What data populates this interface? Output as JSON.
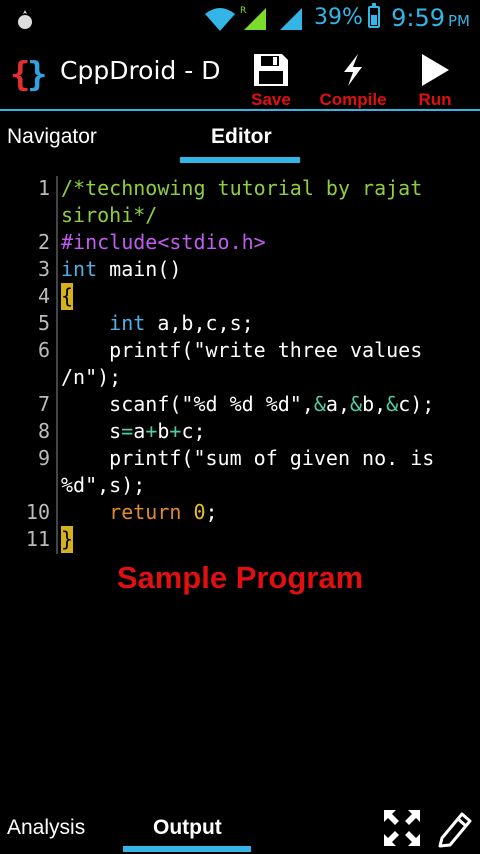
{
  "status": {
    "battery_pct": "39%",
    "time": "9:59",
    "ampm": "PM"
  },
  "app": {
    "title": "CppDroid - D"
  },
  "actions": {
    "save": "Save",
    "compile": "Compile",
    "run": "Run"
  },
  "tabs": [
    {
      "label": "Navigator"
    },
    {
      "label": "Editor"
    }
  ],
  "editor": {
    "lines": [
      {
        "n": "1",
        "y": 0
      },
      {
        "n": "",
        "y": 1
      },
      {
        "n": "2",
        "y": 2
      },
      {
        "n": "3",
        "y": 3
      },
      {
        "n": "4",
        "y": 4
      },
      {
        "n": "5",
        "y": 5
      },
      {
        "n": "6",
        "y": 6
      },
      {
        "n": "",
        "y": 7
      },
      {
        "n": "7",
        "y": 8
      },
      {
        "n": "8",
        "y": 9
      },
      {
        "n": "9",
        "y": 10
      },
      {
        "n": "",
        "y": 11
      },
      {
        "n": "10",
        "y": 12
      },
      {
        "n": "11",
        "y": 13
      }
    ],
    "code": {
      "l1": "/*technowing tutorial by rajat",
      "l1b": "sirohi*/",
      "l2": "#include<stdio.h>",
      "l3_kw": "int",
      "l3_rest": " main()",
      "l4": "{",
      "l5_indent": "    ",
      "l5_kw": "int",
      "l5_rest": " a,b,c,s;",
      "l6": "    printf(\"write three values",
      "l6b": "/n\");",
      "l7_a": "    scanf(\"%d %d %d\",",
      "l7_amp1": "&",
      "l7_b": "a,",
      "l7_amp2": "&",
      "l7_c": "b,",
      "l7_amp3": "&",
      "l7_d": "c);",
      "l8_a": "    s",
      "l8_eq": "=",
      "l8_b": "a",
      "l8_p1": "+",
      "l8_c": "b",
      "l8_p2": "+",
      "l8_d": "c;",
      "l9": "    printf(\"sum of given no. is",
      "l9b": "%d\",s);",
      "l10_indent": "    ",
      "l10_kw": "return",
      "l10_sp": " ",
      "l10_num": "0",
      "l10_end": ";",
      "l11": "}"
    }
  },
  "caption": "Sample Program",
  "bottom_tabs": [
    {
      "label": "Analysis"
    },
    {
      "label": "Output"
    }
  ],
  "colors": {
    "accent": "#33b5e5",
    "action_label": "#e01010"
  },
  "icons": [
    "notification-icon",
    "wifi-icon",
    "signal-icon",
    "battery-icon",
    "app-logo-icon",
    "save-icon",
    "compile-icon",
    "run-icon",
    "fullscreen-icon",
    "edit-icon"
  ]
}
